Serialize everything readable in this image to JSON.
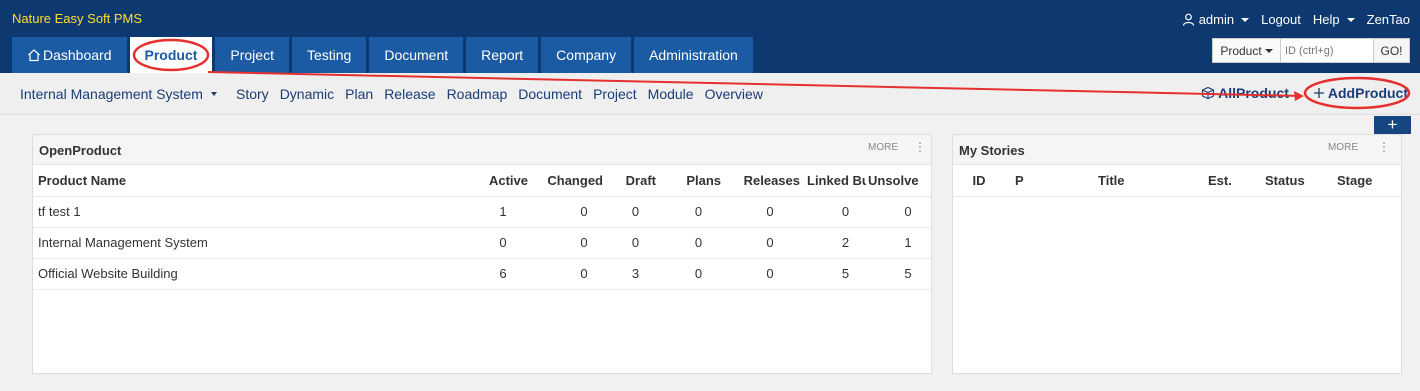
{
  "app": {
    "brand": "Nature Easy Soft PMS"
  },
  "topbar": {
    "user": "admin",
    "logout": "Logout",
    "help": "Help",
    "zentao": "ZenTao"
  },
  "mainnav": {
    "tabs": [
      "Dashboard",
      "Product",
      "Project",
      "Testing",
      "Document",
      "Report",
      "Company",
      "Administration"
    ],
    "active": "Product"
  },
  "search": {
    "type": "Product",
    "placeholder": "ID (ctrl+g)",
    "go": "GO!"
  },
  "subnav": {
    "product": "Internal Management System",
    "links": [
      "Story",
      "Dynamic",
      "Plan",
      "Release",
      "Roadmap",
      "Document",
      "Project",
      "Module",
      "Overview"
    ],
    "all_product": "AllProduct",
    "add_product": "AddProduct"
  },
  "add_block": "+",
  "open_product": {
    "title": "OpenProduct",
    "more": "MORE",
    "columns": [
      "Product Name",
      "Active",
      "Changed",
      "Draft",
      "Plans",
      "Releases",
      "Linked Bu",
      "Unsolve"
    ],
    "rows": [
      [
        "tf test 1",
        "1",
        "0",
        "0",
        "0",
        "0",
        "0",
        "0"
      ],
      [
        "Internal Management System",
        "0",
        "0",
        "0",
        "0",
        "0",
        "2",
        "1"
      ],
      [
        "Official Website Building",
        "6",
        "0",
        "3",
        "0",
        "0",
        "5",
        "5"
      ]
    ]
  },
  "my_stories": {
    "title": "My Stories",
    "more": "MORE",
    "columns": [
      "ID",
      "P",
      "Title",
      "Est.",
      "Status",
      "Stage"
    ]
  },
  "colors": {
    "header": "#0e3970",
    "tab": "#1a5ba3",
    "brand": "#ffde2e",
    "link": "#1a3d75",
    "annotation": "#e53030"
  }
}
